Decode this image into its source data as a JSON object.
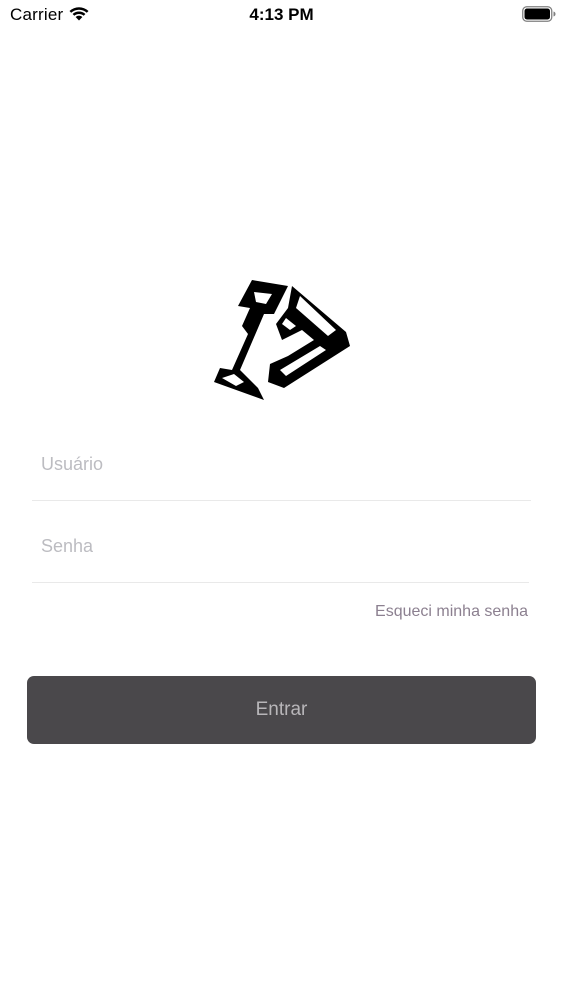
{
  "status_bar": {
    "carrier": "Carrier",
    "time": "4:13 PM",
    "wifi_icon": "wifi-icon",
    "battery_icon": "battery-full-icon"
  },
  "logo": {
    "icon": "app-logo-icon",
    "color": "#000000"
  },
  "form": {
    "username_placeholder": "Usuário",
    "username_value": "",
    "password_placeholder": "Senha",
    "password_value": "",
    "forgot_password_label": "Esqueci minha senha",
    "submit_label": "Entrar"
  },
  "colors": {
    "button_background": "#4a484b",
    "button_text": "#b8b6b9",
    "link": "#8c8090",
    "placeholder": "#bcbcc1"
  }
}
